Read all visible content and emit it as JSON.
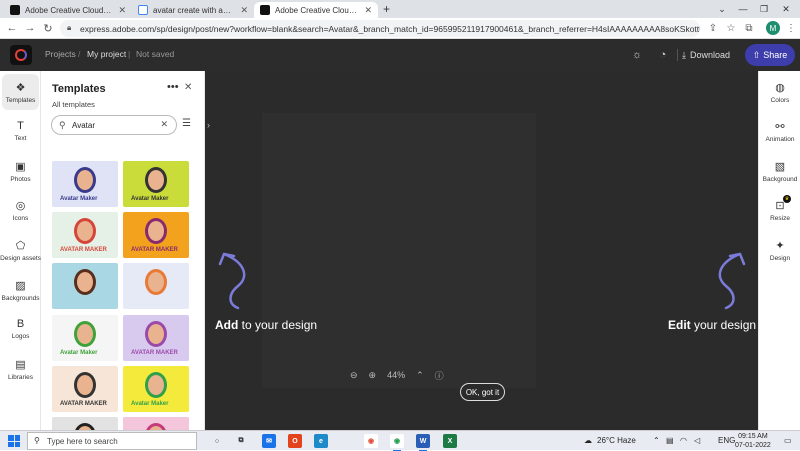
{
  "browser": {
    "tabs": [
      {
        "label": "Adobe Creative Cloud Express (Be",
        "favicon_color": "#111111",
        "active": false
      },
      {
        "label": "avatar create with adobe creative",
        "favicon_color": "#4285f4",
        "active": false
      },
      {
        "label": "Adobe Creative Cloud Express",
        "favicon_color": "#111111",
        "active": true
      }
    ],
    "new_tab": "+",
    "url": "express.adobe.com/sp/design/post/new?workflow=blank&search=Avatar&_branch_match_id=965995211917900461&_branch_referrer=H4sIAAAAAAAAA8soKSkottLXT0zJT0otLkgs...",
    "profile_initial": "M"
  },
  "header": {
    "projects_label": "Projects",
    "my_project_label": "My project",
    "not_saved_label": "Not saved",
    "download_label": "Download",
    "share_label": "Share"
  },
  "left_rail": [
    {
      "label": "Templates",
      "icon": "templates-icon",
      "glyph": "❖"
    },
    {
      "label": "Text",
      "icon": "text-icon",
      "glyph": "T"
    },
    {
      "label": "Photos",
      "icon": "photos-icon",
      "glyph": "▣"
    },
    {
      "label": "Icons",
      "icon": "icons-icon",
      "glyph": "◎"
    },
    {
      "label": "Design assets",
      "icon": "design-assets-icon",
      "glyph": "⬠"
    },
    {
      "label": "Backgrounds",
      "icon": "backgrounds-icon",
      "glyph": "▨"
    },
    {
      "label": "Logos",
      "icon": "logos-icon",
      "glyph": "B"
    },
    {
      "label": "Libraries",
      "icon": "libraries-icon",
      "glyph": "▤"
    }
  ],
  "panel": {
    "title": "Templates",
    "subtitle": "All templates",
    "search_value": "Avatar",
    "thumbnails": [
      {
        "label": "Avatar Maker",
        "bg": "#dfe3f5",
        "accent": "#3a3a8c"
      },
      {
        "label": "Avatar Maker",
        "bg": "#c9dc3a",
        "accent": "#333333"
      },
      {
        "label": "AVATAR MAKER",
        "bg": "#e5f1e6",
        "accent": "#d6453a"
      },
      {
        "label": "AVATAR MAKER",
        "bg": "#f2a21c",
        "accent": "#8a2a6e"
      },
      {
        "label": "",
        "bg": "#a9d8e4",
        "accent": "#5a2e1c"
      },
      {
        "label": "",
        "bg": "#e6e9f6",
        "accent": "#e87a35"
      },
      {
        "label": "Avatar Maker",
        "bg": "#f5f5f5",
        "accent": "#3fa33a"
      },
      {
        "label": "AVATAR MAKER",
        "bg": "#d8c9ef",
        "accent": "#9b4aa8"
      },
      {
        "label": "AVATAR MAKER",
        "bg": "#f7e6d8",
        "accent": "#333333"
      },
      {
        "label": "Avatar Maker",
        "bg": "#f4ea3c",
        "accent": "#2fa04a"
      },
      {
        "label": "",
        "bg": "#e2e2e2",
        "accent": "#222222"
      },
      {
        "label": "",
        "bg": "#f3c6dc",
        "accent": "#c43a7a"
      }
    ]
  },
  "canvas": {
    "add_bold": "Add",
    "add_rest": " to your design",
    "edit_bold": "Edit",
    "edit_rest": " your design",
    "zoom_level": "44%",
    "ok_label": "OK, got it",
    "accent_color": "#7b7bd9"
  },
  "right_rail": [
    {
      "label": "Colors",
      "icon": "colors-icon",
      "glyph": "◍"
    },
    {
      "label": "Animation",
      "icon": "animation-icon",
      "glyph": "⚯"
    },
    {
      "label": "Background",
      "icon": "background-icon",
      "glyph": "▧"
    },
    {
      "label": "Resize",
      "icon": "resize-icon",
      "glyph": "⊡"
    },
    {
      "label": "Design",
      "icon": "design-icon",
      "glyph": "✦"
    }
  ],
  "taskbar": {
    "search_placeholder": "Type here to search",
    "apps": [
      {
        "name": "cortana-icon",
        "glyph": "○",
        "color": "transparent",
        "text_color": "#222"
      },
      {
        "name": "task-view-icon",
        "glyph": "⧉",
        "color": "transparent",
        "text_color": "#222"
      },
      {
        "name": "mail-app-icon",
        "glyph": "✉",
        "color": "#1a73e8",
        "text_color": "#fff"
      },
      {
        "name": "office-app-icon",
        "glyph": "O",
        "color": "#e2431c",
        "text_color": "#fff"
      },
      {
        "name": "edge-app-icon",
        "glyph": "e",
        "color": "#1f8ac9",
        "text_color": "#fff"
      },
      {
        "name": "chrome-app-icon",
        "glyph": "◉",
        "color": "#ffffff",
        "text_color": "#e24b3b"
      },
      {
        "name": "chrome-app-icon-2",
        "glyph": "◉",
        "color": "#ffffff",
        "text_color": "#1f9e4a"
      },
      {
        "name": "word-app-icon",
        "glyph": "W",
        "color": "#2b5fb7",
        "text_color": "#fff"
      },
      {
        "name": "excel-app-icon",
        "glyph": "X",
        "color": "#1e7a45",
        "text_color": "#fff"
      }
    ],
    "weather": "26°C  Haze",
    "language": "ENG",
    "time": "09:15 AM",
    "date": "07-01-2022"
  }
}
